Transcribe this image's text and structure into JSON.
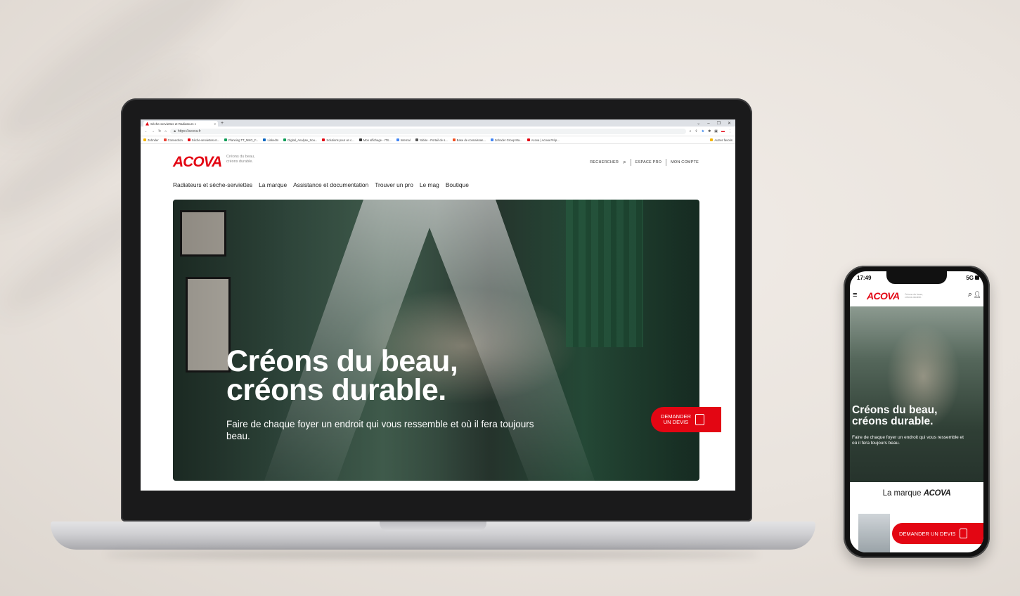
{
  "browser": {
    "tab_title": "Sèche-serviettes et Radiateurs c",
    "new_tab": "+",
    "url": "https://acova.fr",
    "bookmarks": [
      "Zehnder",
      "Connection",
      "Sèche-serviettes et...",
      "Planning TT_MKG_F...",
      "LinkedIn",
      "Digital_Analyse_Sou...",
      "Solutions pour un c...",
      "Mon affichage - ITS...",
      "Internal",
      "Yabire - Portail de s...",
      "Base de connaissan...",
      "Zehnder Group Ma...",
      "Acova | Acova Prép...",
      "Autres favoris"
    ],
    "bookmark_colors": [
      "#f4b400",
      "#ea4335",
      "#e30613",
      "#0f9d58",
      "#0a66c2",
      "#0f9d58",
      "#e30613",
      "#333333",
      "#4285f4",
      "#555555",
      "#f25022",
      "#4285f4",
      "#e30613",
      "#f4b400"
    ]
  },
  "site": {
    "logo": "ACOVA",
    "tagline": "Créons du beau, créons durable.",
    "util": {
      "search": "RECHERCHER",
      "pro": "ESPACE PRO",
      "account": "MON COMPTE"
    },
    "nav": [
      "Radiateurs et sèche-serviettes",
      "La marque",
      "Assistance et documentation",
      "Trouver un pro",
      "Le mag",
      "Boutique"
    ],
    "hero": {
      "title_line1": "Créons du beau,",
      "title_line2": "créons durable.",
      "subtitle": "Faire de chaque foyer un endroit qui vous ressemble et où il fera toujours beau."
    },
    "cta": {
      "line1": "DEMANDER",
      "line2": "UN DEVIS"
    }
  },
  "phone": {
    "time": "17:49",
    "network": "5G",
    "logo": "ACOVA",
    "tagline": "Créons du beau, créons durable.",
    "hero_title_line1": "Créons du beau,",
    "hero_title_line2": "créons durable.",
    "hero_subtitle": "Faire de chaque foyer un endroit qui vous ressemble et où il fera toujours beau.",
    "marque_label": "La marque",
    "marque_logo": "ACOVA",
    "cta": "DEMANDER UN DEVIS"
  },
  "colors": {
    "brand": "#e30613",
    "background": "#ebe6e0"
  }
}
